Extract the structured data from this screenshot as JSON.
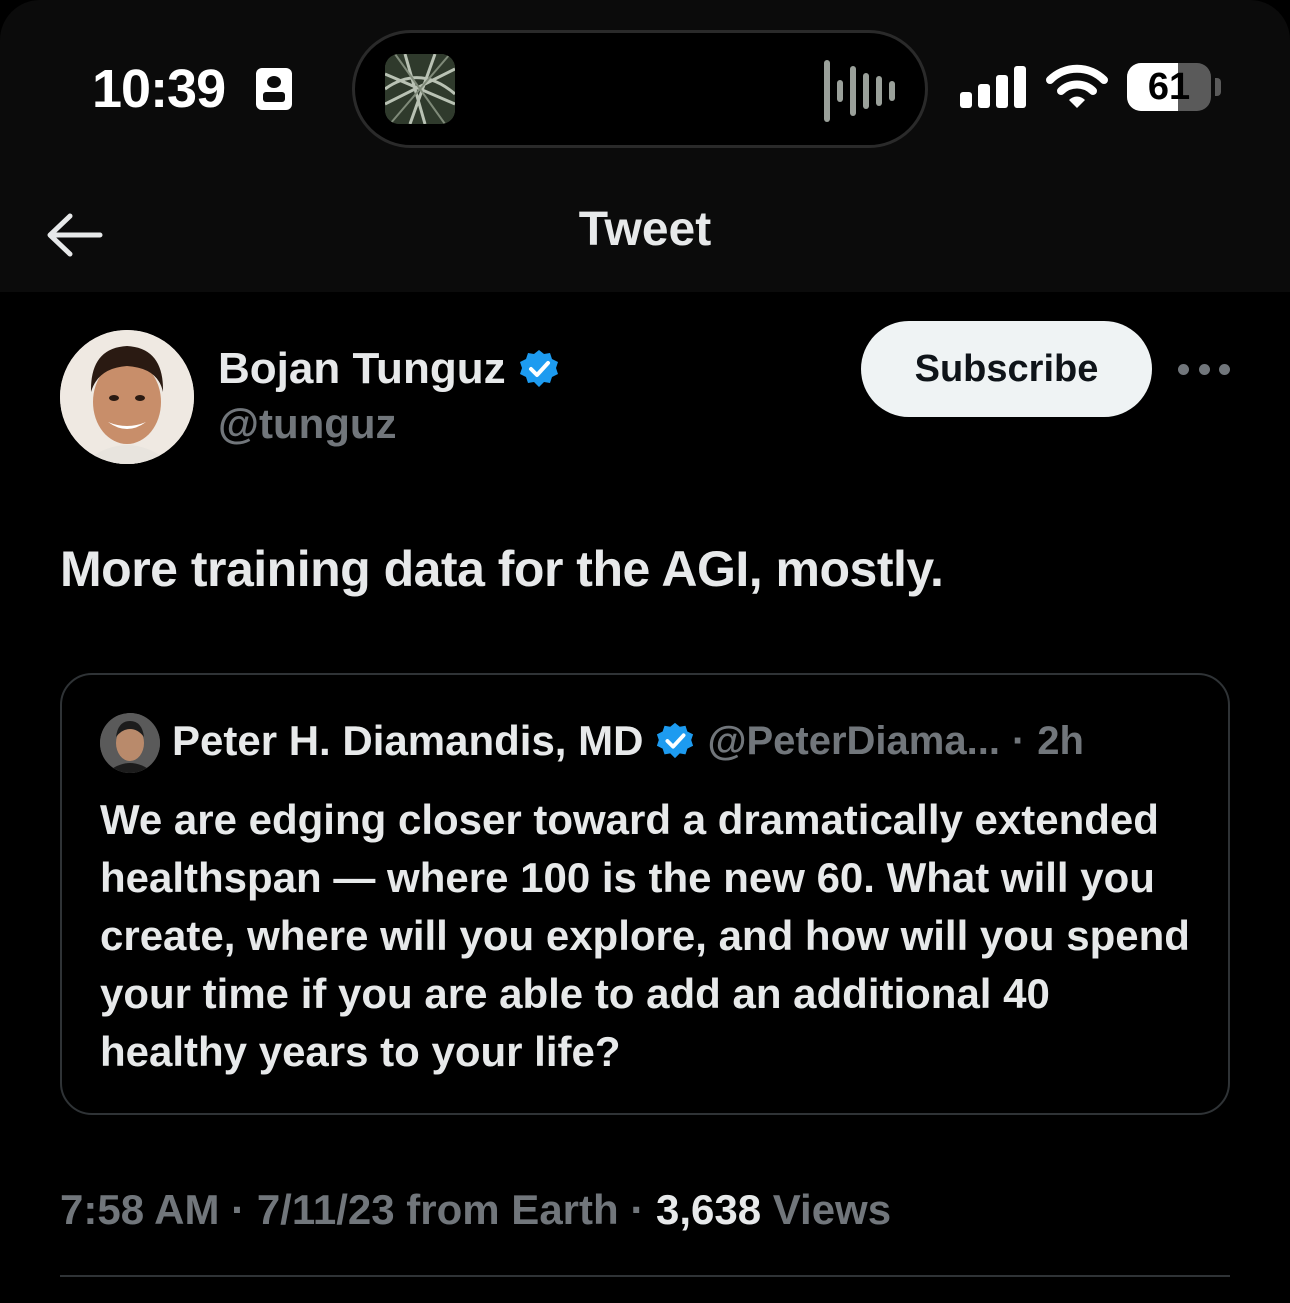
{
  "status_bar": {
    "time": "10:39",
    "battery": "61",
    "battery_level": 0.61
  },
  "nav": {
    "title": "Tweet"
  },
  "tweet": {
    "author": {
      "name": "Bojan Tunguz",
      "handle": "@tunguz",
      "verified": true
    },
    "subscribe_label": "Subscribe",
    "text": "More training data for the AGI, mostly.",
    "quote": {
      "name": "Peter H. Diamandis, MD",
      "handle": "@PeterDiama...",
      "separator": "·",
      "age": "2h",
      "text": "We are edging closer toward a dramatically extended healthspan — where 100 is the new 60. What will you create, where will you explore, and how will you spend your time if you are able to add an additional 40 healthy years to your life?"
    },
    "meta": {
      "time": "7:58 AM",
      "sep1": " · ",
      "date": "7/11/23",
      "source": " from Earth",
      "sep2": " · ",
      "views_count": "3,638",
      "views_label": " Views"
    }
  },
  "colors": {
    "background": "#000000",
    "text": "#e7e9ea",
    "muted": "#71767b",
    "verified": "#1d9bf0",
    "border": "#2f3336"
  },
  "icons": [
    "id-badge-icon",
    "audio-wave-icon",
    "cellular-signal-icon",
    "wifi-icon",
    "battery-icon",
    "back-arrow-icon",
    "verified-badge-icon",
    "more-options-icon"
  ]
}
